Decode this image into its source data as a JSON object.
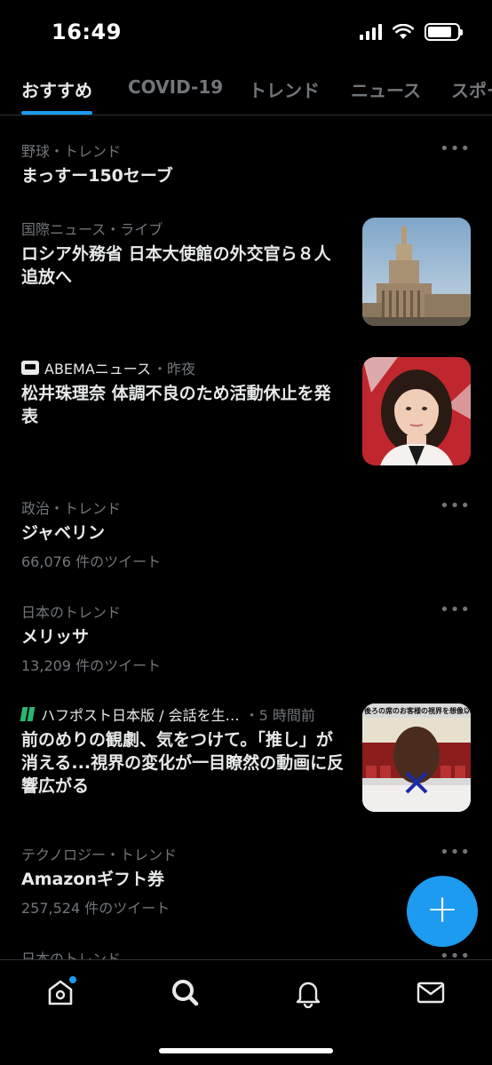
{
  "status": {
    "time": "16:49"
  },
  "tabs": [
    {
      "label": "おすすめ",
      "active": true
    },
    {
      "label": "COVID-19"
    },
    {
      "label": "トレンド"
    },
    {
      "label": "ニュース"
    },
    {
      "label": "スポー"
    }
  ],
  "feed": {
    "items": [
      {
        "meta": "野球・トレンド",
        "headline": "まっすー150セーブ",
        "more": "•••"
      },
      {
        "source": "国際ニュース",
        "time": "・ライブ",
        "headline": "ロシア外務省 日本大使館の外交官ら８人追放へ",
        "image": "kremlin-building-photo"
      },
      {
        "source": "ABEMAニュース",
        "time": "・昨夜",
        "headline": "松井珠理奈 体調不良のため活動休止を発表",
        "image": "woman-portrait-photo"
      },
      {
        "meta": "政治・トレンド",
        "headline": "ジャベリン",
        "count": "66,076 件のツイート",
        "more": "•••"
      },
      {
        "meta": "日本のトレンド",
        "headline": "メリッサ",
        "count": "13,209 件のツイート",
        "more": "•••"
      },
      {
        "source": "ハフポスト日本版 / 会話を生…",
        "time": "・5 時間前",
        "headline": "前のめりの観劇、気をつけて。「推し」が消える...視界の変化が一目瞭然の動画に反響広がる",
        "image": "theater-seat-illustration",
        "image_caption": "後ろの席のお客様の視界を想像以上"
      },
      {
        "meta": "テクノロジー・トレンド",
        "headline": "Amazonギフト券",
        "count": "257,524 件のツイート",
        "more": "•••"
      },
      {
        "meta": "日本のトレンド",
        "more": "•••"
      }
    ]
  },
  "fab": {
    "label": "+"
  },
  "nav": [
    "home-icon",
    "search-icon",
    "bell-icon",
    "mail-icon"
  ],
  "colors": {
    "accent": "#1d9bf0",
    "background": "#000000",
    "text": "#e7e9ea",
    "muted": "#71767b"
  }
}
